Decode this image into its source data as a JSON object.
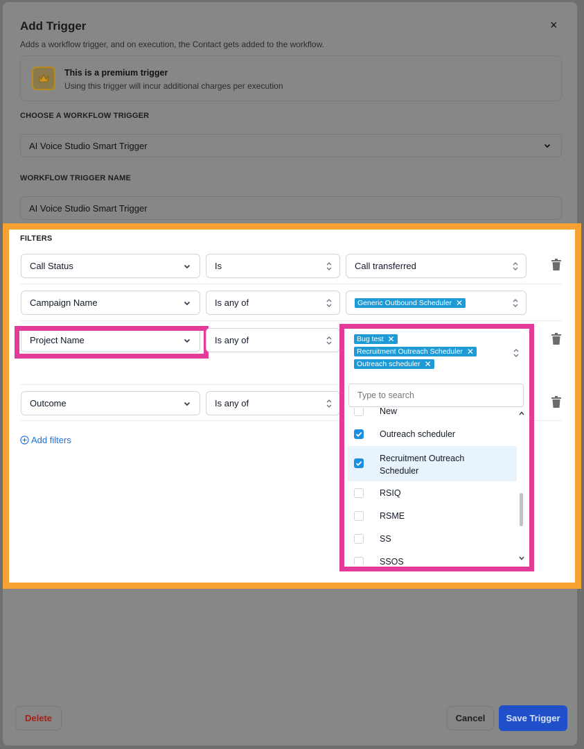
{
  "dialog": {
    "title": "Add Trigger",
    "subtitle": "Adds a workflow trigger, and on execution, the Contact gets added to the workflow.",
    "close_icon": "×"
  },
  "premium": {
    "title": "This is a premium trigger",
    "subtitle": "Using this trigger will incur additional charges per execution",
    "icon": "crown-icon"
  },
  "choose_trigger": {
    "label": "CHOOSE A WORKFLOW TRIGGER",
    "value": "AI Voice Studio Smart Trigger"
  },
  "trigger_name": {
    "label": "WORKFLOW TRIGGER NAME",
    "value": "AI Voice Studio Smart Trigger"
  },
  "filters": {
    "label": "FILTERS",
    "rows": [
      {
        "field": "Call Status",
        "operator": "Is",
        "value": "Call transferred"
      },
      {
        "field": "Campaign Name",
        "operator": "Is any of",
        "tags": [
          "Generic Outbound Scheduler"
        ]
      },
      {
        "field": "Project Name",
        "operator": "Is any of",
        "tags": [
          "Bug test",
          "Recruitment Outreach Scheduler",
          "Outreach scheduler"
        ]
      },
      {
        "field": "Outcome",
        "operator": "Is any of"
      }
    ],
    "add_label": "Add filters"
  },
  "dropdown": {
    "search_placeholder": "Type to search",
    "options": [
      {
        "label": "New",
        "checked": false
      },
      {
        "label": "Outreach scheduler",
        "checked": true
      },
      {
        "label": "Recruitment Outreach Scheduler",
        "checked": true
      },
      {
        "label": "RSIQ",
        "checked": false
      },
      {
        "label": "RSME",
        "checked": false
      },
      {
        "label": "SS",
        "checked": false
      },
      {
        "label": "SSOS",
        "checked": false
      }
    ]
  },
  "footer": {
    "delete_label": "Delete",
    "cancel_label": "Cancel",
    "save_label": "Save Trigger"
  },
  "colors": {
    "accent": "#1b8fe0",
    "tag": "#1e9ad6",
    "highlight_orange": "#f7a233",
    "highlight_pink": "#e43b9a",
    "save_button": "#1f4fc9",
    "delete_text": "#a8201a"
  }
}
